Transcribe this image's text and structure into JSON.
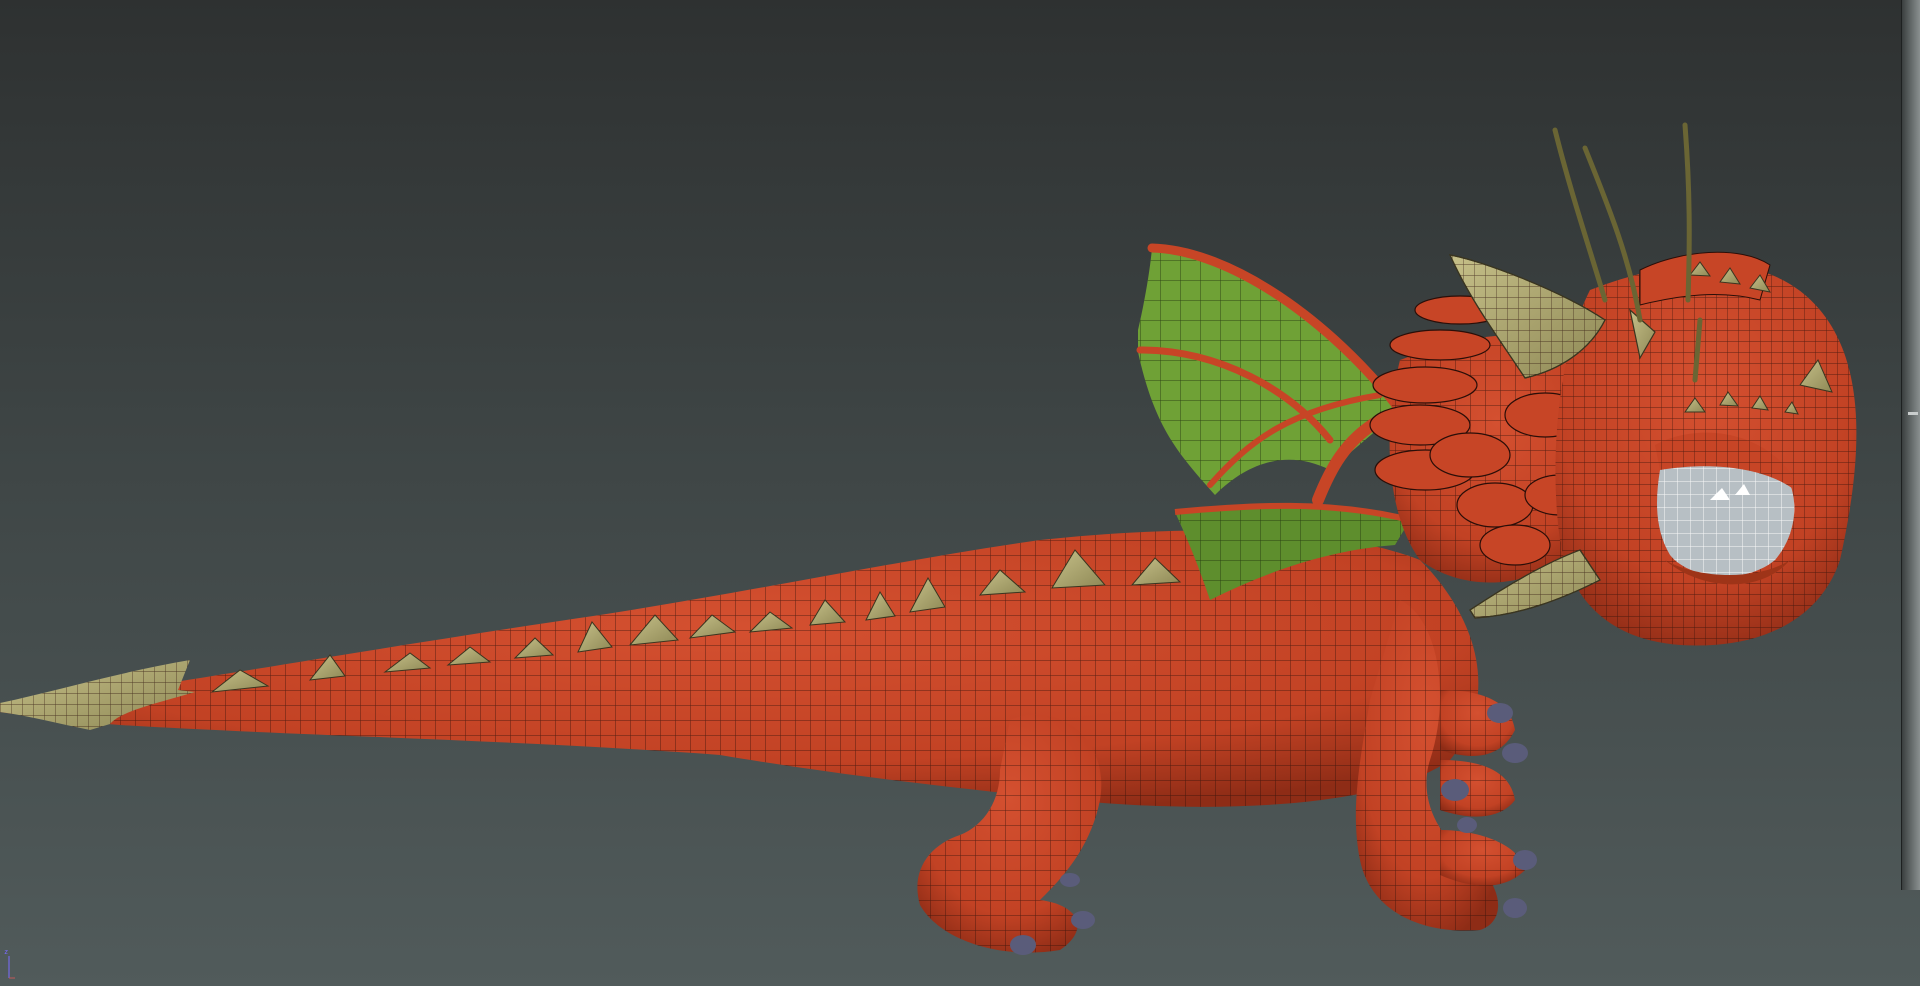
{
  "viewport": {
    "axis_z_label": "z",
    "colors": {
      "body": "#c74526",
      "wireframe": "#2a0e08",
      "wing_membrane": "#6fa136",
      "horn": "#a7a169",
      "claw": "#5a5c7a",
      "eye": "#b7bfc4",
      "background_top": "#2e3131",
      "background_bottom": "#515b5b"
    },
    "icons": [
      "dragon-model",
      "axis-gizmo-icon"
    ]
  }
}
